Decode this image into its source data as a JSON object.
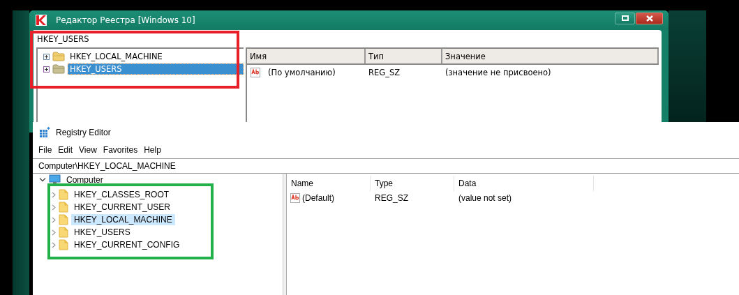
{
  "kaspersky_window": {
    "title": "Редактор Реестра [Windows 10]",
    "address": "HKEY_USERS",
    "tree": [
      {
        "label": "HKEY_LOCAL_MACHINE",
        "selected": false
      },
      {
        "label": "HKEY_USERS",
        "selected": true
      }
    ],
    "columns": [
      "Имя",
      "Тип",
      "Значение"
    ],
    "rows": [
      {
        "name": "(По умолчанию)",
        "type": "REG_SZ",
        "data": "(значение не присвоено)"
      }
    ]
  },
  "registry_editor": {
    "title": "Registry Editor",
    "menu": [
      "File",
      "Edit",
      "View",
      "Favorites",
      "Help"
    ],
    "address": "Computer\\HKEY_LOCAL_MACHINE",
    "tree": {
      "label": "Computer",
      "expanded": true,
      "children": [
        {
          "label": "HKEY_CLASSES_ROOT",
          "selected": false
        },
        {
          "label": "HKEY_CURRENT_USER",
          "selected": false
        },
        {
          "label": "HKEY_LOCAL_MACHINE",
          "selected": true
        },
        {
          "label": "HKEY_USERS",
          "selected": false
        },
        {
          "label": "HKEY_CURRENT_CONFIG",
          "selected": false
        }
      ]
    },
    "columns": [
      "Name",
      "Type",
      "Data"
    ],
    "rows": [
      {
        "name": "(Default)",
        "type": "REG_SZ",
        "data": "(value not set)"
      }
    ]
  },
  "annotations": [
    {
      "color": "#e8202a"
    },
    {
      "color": "#22b04a"
    }
  ]
}
